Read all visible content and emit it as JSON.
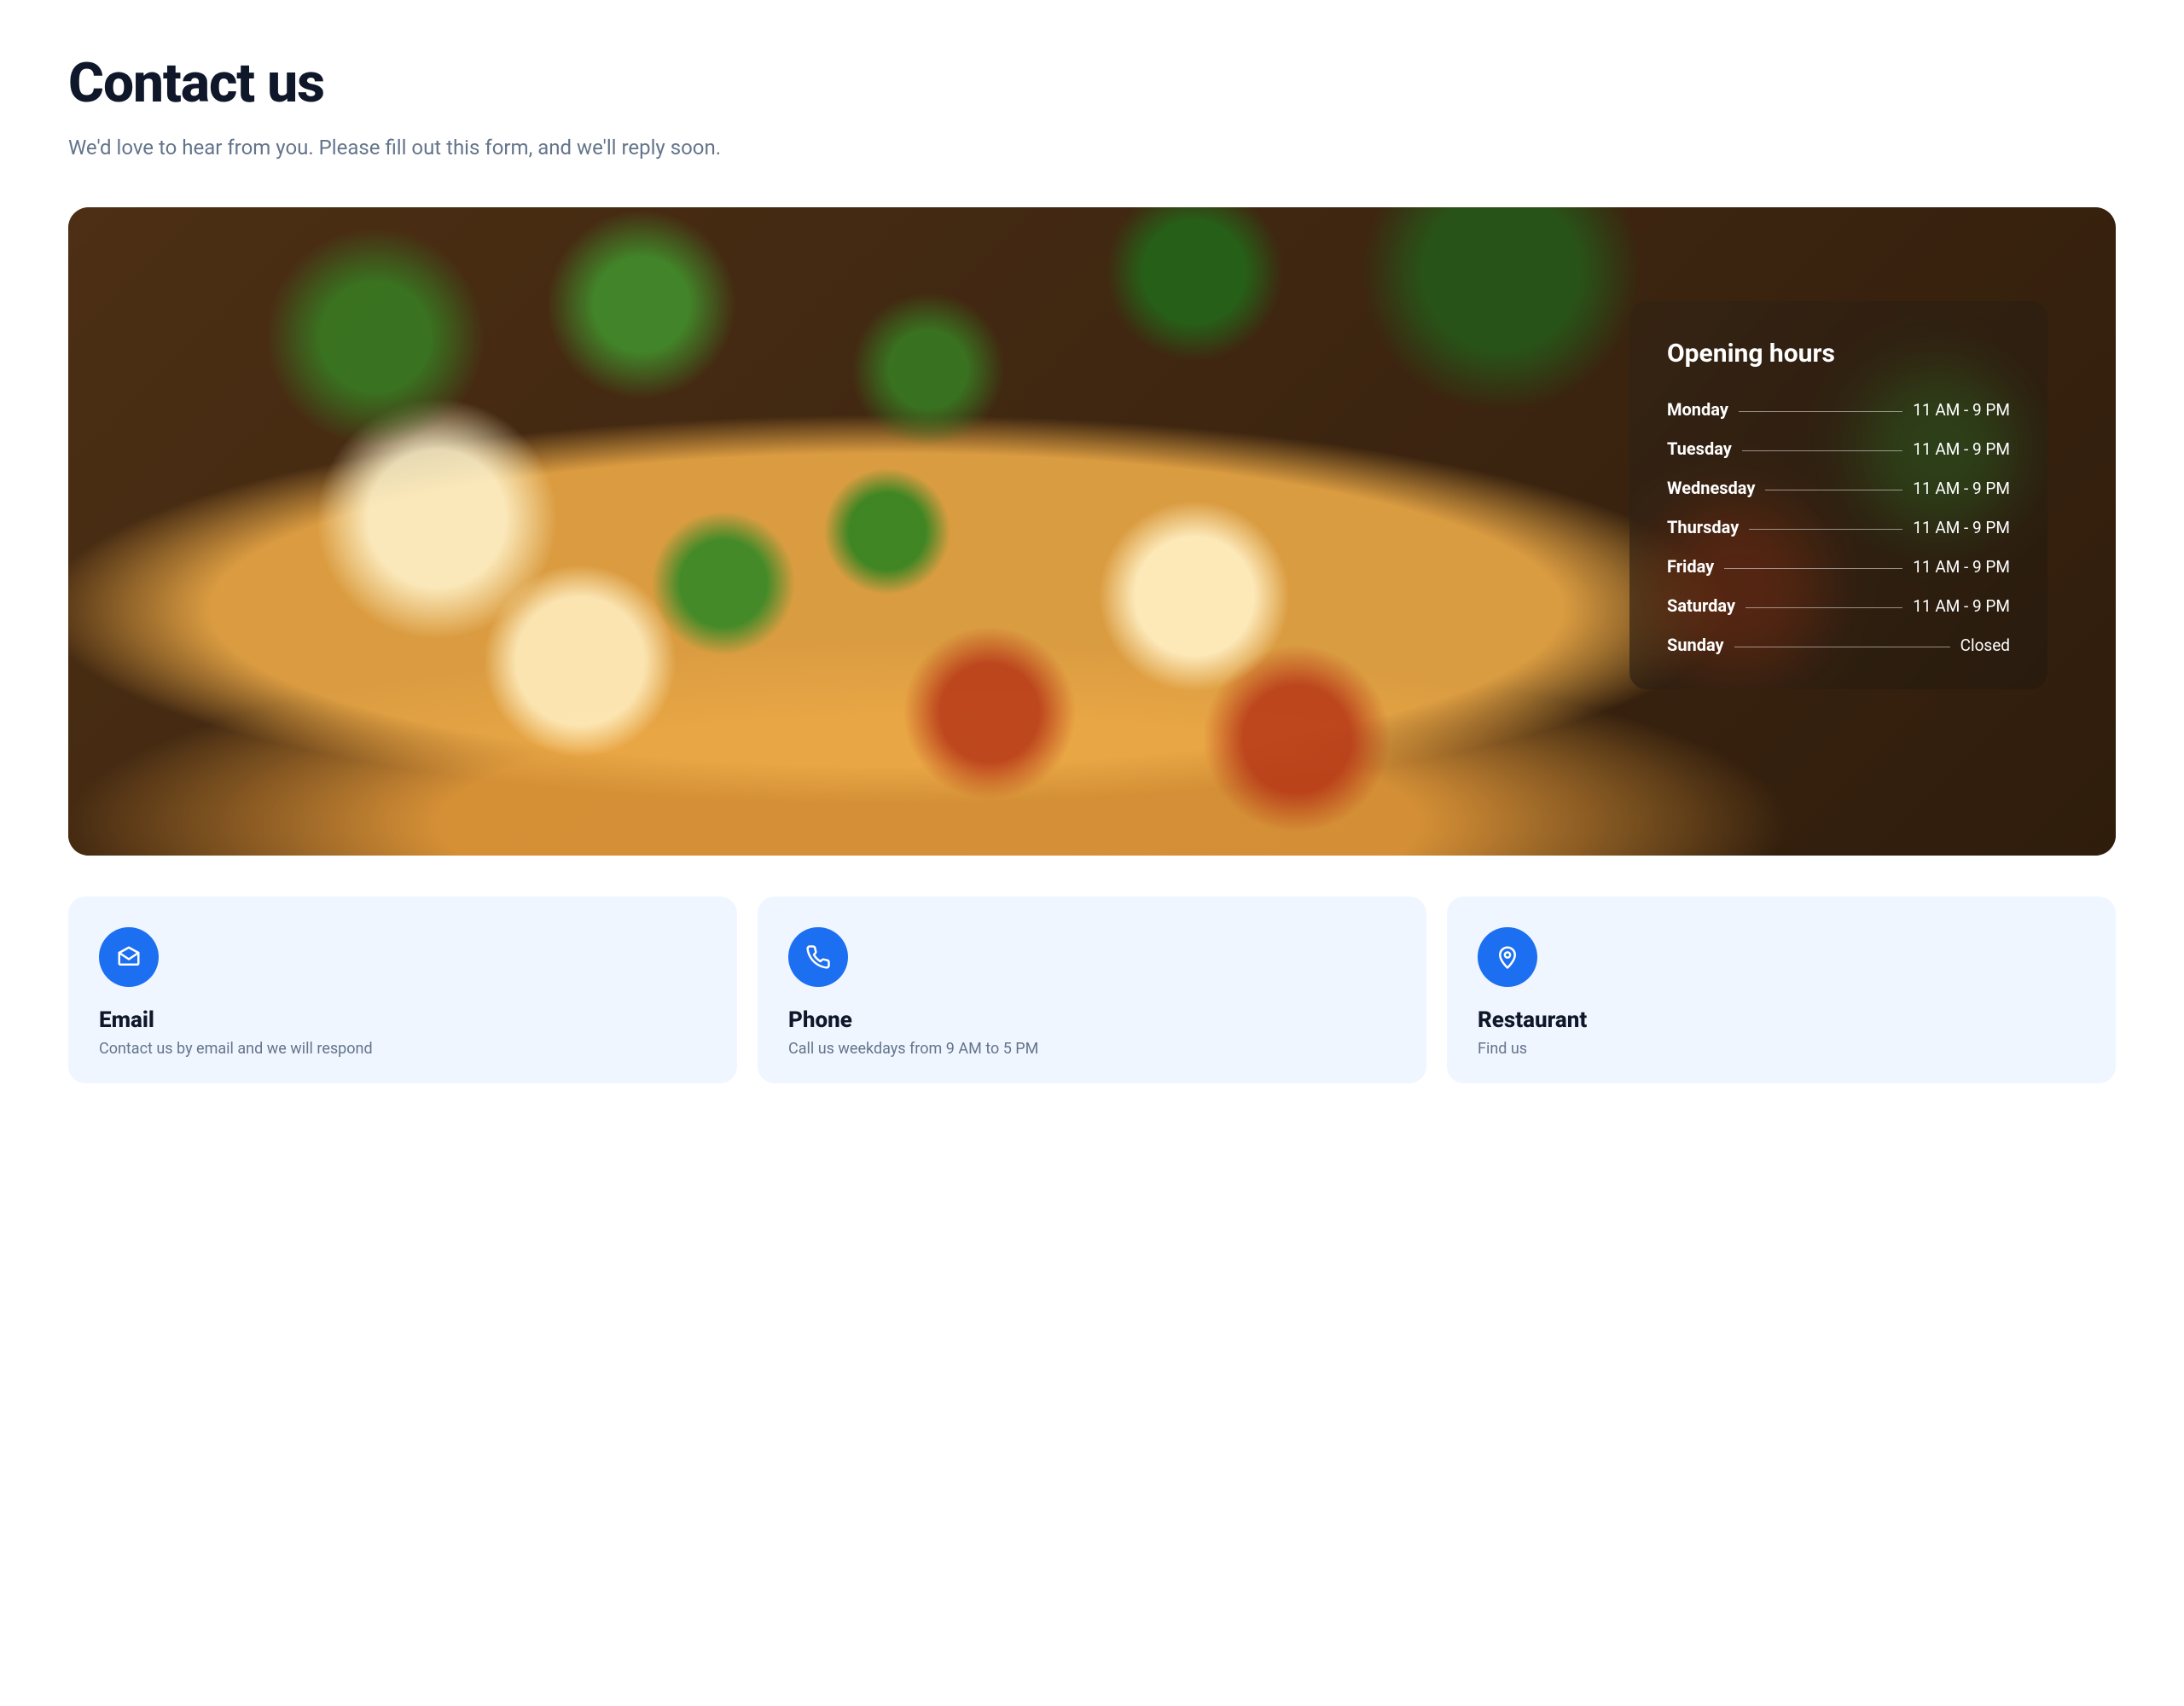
{
  "header": {
    "title": "Contact us",
    "subtitle": "We'd love to hear from you. Please fill out this form, and we'll reply soon."
  },
  "opening_hours": {
    "title": "Opening hours",
    "days": [
      {
        "day": "Monday",
        "hours": "11 AM - 9 PM"
      },
      {
        "day": "Tuesday",
        "hours": "11 AM - 9 PM"
      },
      {
        "day": "Wednesday",
        "hours": "11 AM - 9 PM"
      },
      {
        "day": "Thursday",
        "hours": "11 AM - 9 PM"
      },
      {
        "day": "Friday",
        "hours": "11 AM - 9 PM"
      },
      {
        "day": "Saturday",
        "hours": "11 AM - 9 PM"
      },
      {
        "day": "Sunday",
        "hours": "Closed"
      }
    ]
  },
  "contact_cards": [
    {
      "icon": "mail-icon",
      "title": "Email",
      "subtitle": "Contact us by email and we will respond"
    },
    {
      "icon": "phone-icon",
      "title": "Phone",
      "subtitle": "Call us weekdays from 9 AM to 5 PM"
    },
    {
      "icon": "pin-icon",
      "title": "Restaurant",
      "subtitle": "Find us"
    }
  ]
}
